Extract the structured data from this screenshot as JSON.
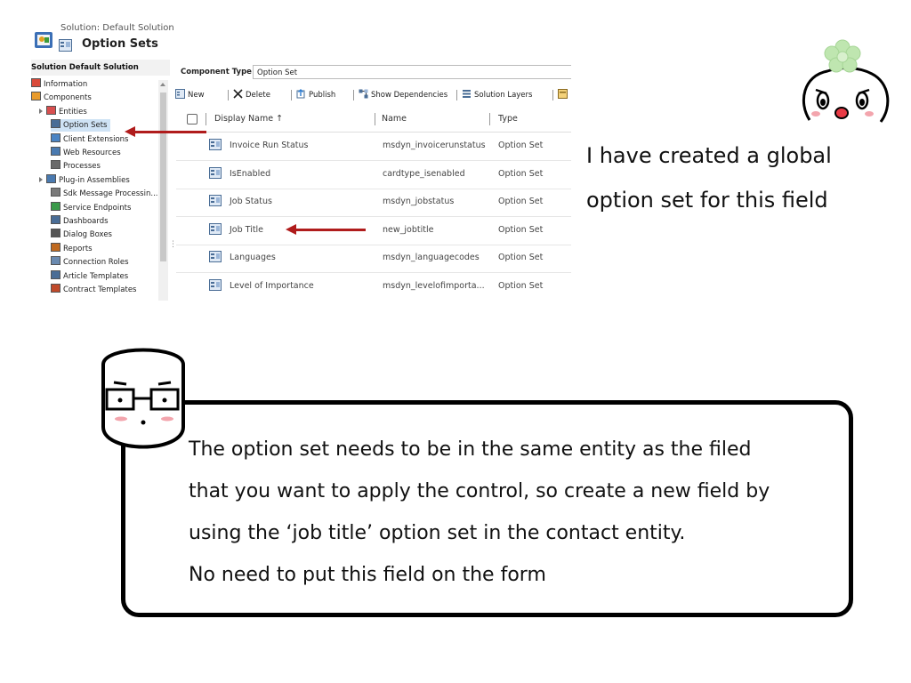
{
  "explorer": {
    "breadcrumb": "Solution: Default Solution",
    "title": "Option Sets",
    "solution_name": "Solution Default Solution",
    "tree": [
      {
        "label": "Information",
        "icon": "information-icon",
        "indent": 0,
        "expander": false
      },
      {
        "label": "Components",
        "icon": "components-icon",
        "indent": 0,
        "expander": false
      },
      {
        "label": "Entities",
        "icon": "entities-icon",
        "indent": 1,
        "expander": true
      },
      {
        "label": "Option Sets",
        "icon": "option-sets-icon",
        "indent": 2,
        "expander": false,
        "selected": true
      },
      {
        "label": "Client Extensions",
        "icon": "client-extensions-icon",
        "indent": 2,
        "expander": false
      },
      {
        "label": "Web Resources",
        "icon": "web-resources-icon",
        "indent": 2,
        "expander": false
      },
      {
        "label": "Processes",
        "icon": "processes-icon",
        "indent": 2,
        "expander": false
      },
      {
        "label": "Plug-in Assemblies",
        "icon": "plugin-assemblies-icon",
        "indent": 1,
        "expander": true
      },
      {
        "label": "Sdk Message Processin...",
        "icon": "sdk-message-icon",
        "indent": 2,
        "expander": false
      },
      {
        "label": "Service Endpoints",
        "icon": "service-endpoints-icon",
        "indent": 2,
        "expander": false
      },
      {
        "label": "Dashboards",
        "icon": "dashboards-icon",
        "indent": 2,
        "expander": false
      },
      {
        "label": "Dialog Boxes",
        "icon": "dialog-boxes-icon",
        "indent": 2,
        "expander": false
      },
      {
        "label": "Reports",
        "icon": "reports-icon",
        "indent": 2,
        "expander": false
      },
      {
        "label": "Connection Roles",
        "icon": "connection-roles-icon",
        "indent": 2,
        "expander": false
      },
      {
        "label": "Article Templates",
        "icon": "article-templates-icon",
        "indent": 2,
        "expander": false
      },
      {
        "label": "Contract Templates",
        "icon": "contract-templates-icon",
        "indent": 2,
        "expander": false
      }
    ]
  },
  "component_type": {
    "label": "Component Type",
    "value": "Option Set"
  },
  "toolbar": [
    {
      "label": "New",
      "icon": "new-icon"
    },
    {
      "label": "Delete",
      "icon": "delete-icon"
    },
    {
      "label": "Publish",
      "icon": "publish-icon"
    },
    {
      "label": "Show Dependencies",
      "icon": "dependencies-icon"
    },
    {
      "label": "Solution Layers",
      "icon": "solution-layers-icon"
    },
    {
      "label": "",
      "icon": "more-icon"
    }
  ],
  "grid": {
    "columns": [
      "Display Name ↑",
      "Name",
      "Type"
    ],
    "rows": [
      {
        "display_name": "Invoice Run Status",
        "name": "msdyn_invoicerunstatus",
        "type": "Option Set"
      },
      {
        "display_name": "IsEnabled",
        "name": "cardtype_isenabled",
        "type": "Option Set"
      },
      {
        "display_name": "Job Status",
        "name": "msdyn_jobstatus",
        "type": "Option Set"
      },
      {
        "display_name": "Job Title",
        "name": "new_jobtitle",
        "type": "Option Set"
      },
      {
        "display_name": "Languages",
        "name": "msdyn_languagecodes",
        "type": "Option Set"
      },
      {
        "display_name": "Level of Importance",
        "name": "msdyn_levelofimporta...",
        "type": "Option Set"
      }
    ]
  },
  "annotations": {
    "top_note": [
      "I have created a global",
      "option set for this field"
    ],
    "bubble_lines": [
      "The option set needs to be in the same entity as the filed",
      "that you want to apply the control, so create a new field by",
      "using the ‘job title’ option set in the contact entity.",
      "No need to put this field on the form"
    ]
  },
  "colors": {
    "arrow": "#b01c1c",
    "selection": "#cfe3f5",
    "flower": "#bfe6b0"
  }
}
